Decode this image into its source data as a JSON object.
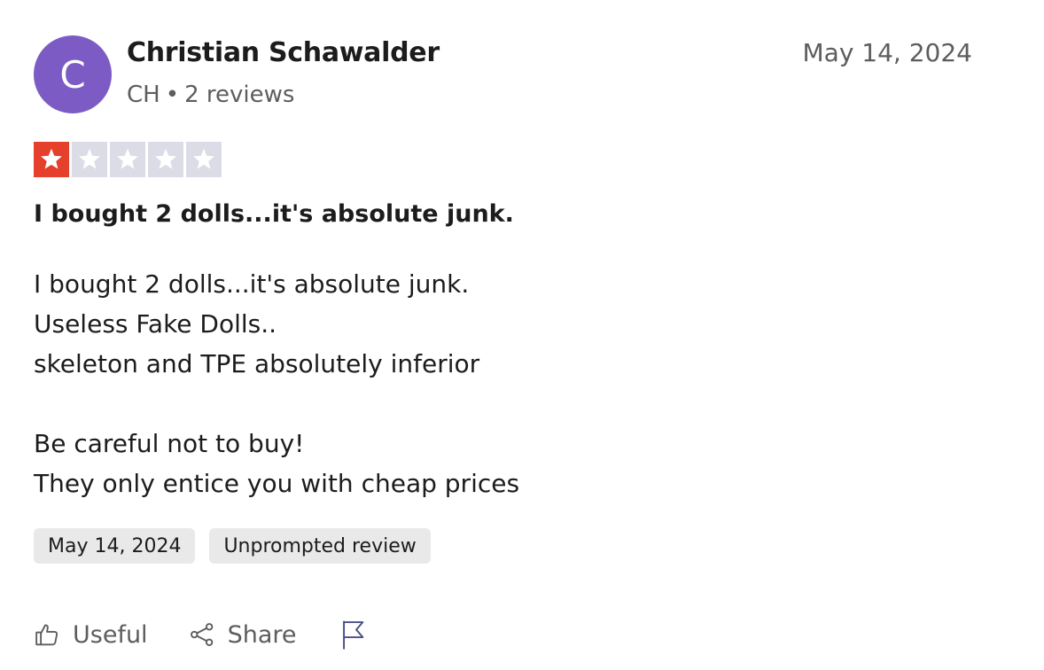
{
  "reviewer": {
    "initial": "C",
    "name": "Christian Schawalder",
    "country": "CH",
    "separator": "•",
    "review_count": "2 reviews",
    "avatar_color": "#7c5cc4"
  },
  "review": {
    "date": "May 14, 2024",
    "rating": 1,
    "max_rating": 5,
    "rating_color_active": "#e5402b",
    "rating_color_inactive": "#dcdce6",
    "title": "I bought 2 dolls...it's absolute junk.",
    "body_lines": [
      "I bought 2 dolls...it's absolute junk.",
      "Useless Fake Dolls..",
      "skeleton and TPE absolutely inferior",
      "",
      "Be careful not to buy!",
      "They only entice you with cheap prices"
    ]
  },
  "tags": [
    "May 14, 2024",
    "Unprompted review"
  ],
  "actions": {
    "useful_label": "Useful",
    "useful_icon": "thumbs-up-icon",
    "share_label": "Share",
    "share_icon": "share-icon",
    "report_icon": "flag-icon"
  }
}
